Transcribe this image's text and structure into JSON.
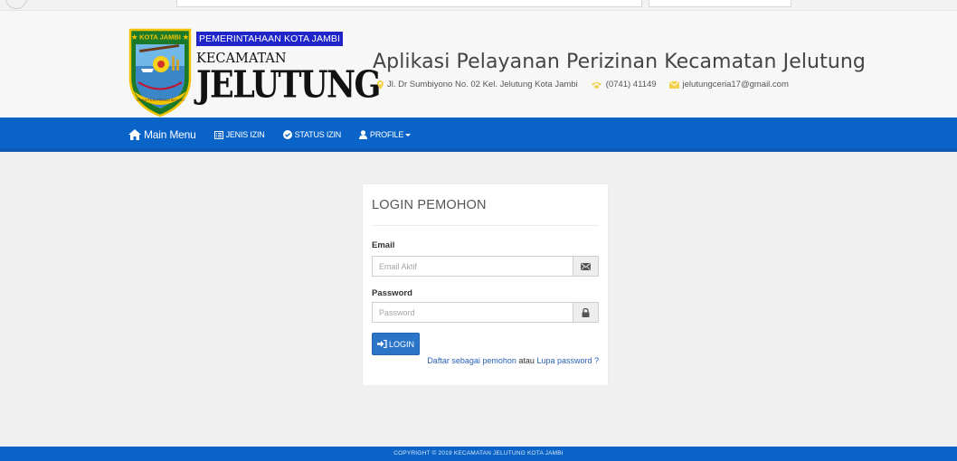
{
  "logo": {
    "banner": "PEMERINTAHAAN KOTA JAMBI",
    "line1": "KECAMATAN",
    "line2": "JELUTUNG",
    "emblem_top_text": "KOTA JAMBI",
    "emblem_ribbon_text": "TANAH PILIH PESAKO BETUAH"
  },
  "header": {
    "title": "Aplikasi Pelayanan Perizinan Kecamatan Jelutung",
    "address": "Jl. Dr Sumbiyono No. 02 Kel. Jelutung Kota Jambi",
    "phone": "(0741) 41149",
    "email": "jelutungceria17@gmail.com"
  },
  "nav": {
    "main": "Main Menu",
    "jenis": "JENIS IZIN",
    "status": "STATUS IZIN",
    "profile": "PROFILE"
  },
  "login": {
    "title": "LOGIN PEMOHON",
    "email_label": "Email",
    "email_placeholder": "Email Aktif",
    "password_label": "Password",
    "password_placeholder": "Password",
    "button": "LOGIN",
    "register_link": "Daftar sebagai pemohon",
    "or_text": "atau",
    "forgot_link": "Lupa password ?"
  },
  "footer": {
    "text": "COPYRIGHT © 2019 KECAMATAN JELUTUNG KOTA JAMBI"
  },
  "colors": {
    "nav_blue": "#0a64c8",
    "banner_blue": "#1f25c9",
    "button_blue": "#2a75c8",
    "link_blue": "#2a5fb8",
    "icon_yellow": "#f1d04b"
  }
}
